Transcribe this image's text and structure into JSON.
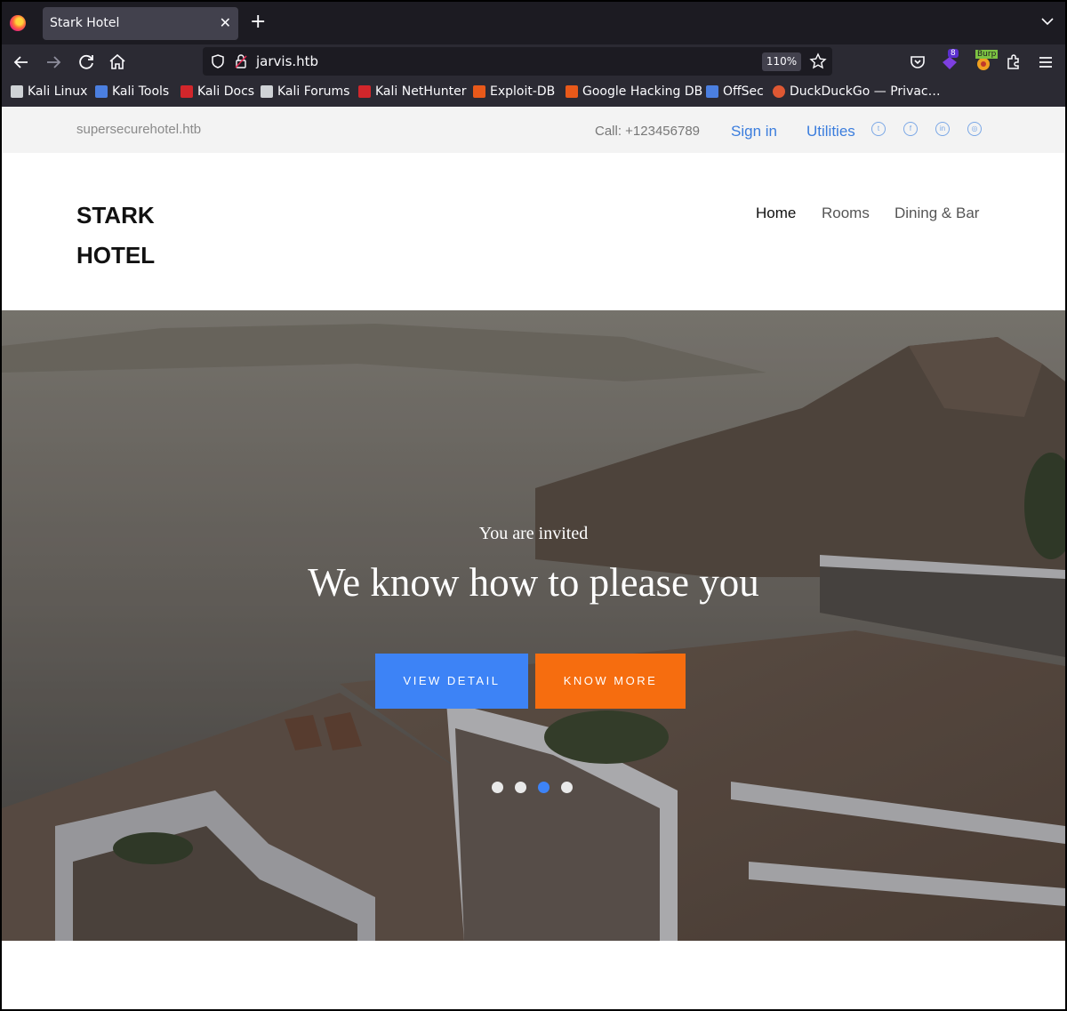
{
  "browser": {
    "tab_title": "Stark Hotel",
    "url": "jarvis.htb",
    "zoom": "110%",
    "extension_badge": "8",
    "burp_label": "Burp",
    "bookmarks": [
      {
        "label": "Kali Linux",
        "icon": "kali-dragon-icon",
        "color": "#cfd2d6"
      },
      {
        "label": "Kali Tools",
        "icon": "kali-tools-icon",
        "color": "#4b7fe0"
      },
      {
        "label": "Kali Docs",
        "icon": "kali-docs-icon",
        "color": "#d2262b"
      },
      {
        "label": "Kali Forums",
        "icon": "kali-forums-icon",
        "color": "#cfd2d6"
      },
      {
        "label": "Kali NetHunter",
        "icon": "nethunter-icon",
        "color": "#d2262b"
      },
      {
        "label": "Exploit-DB",
        "icon": "exploit-db-icon",
        "color": "#e8591a"
      },
      {
        "label": "Google Hacking DB",
        "icon": "ghdb-icon",
        "color": "#e8591a"
      },
      {
        "label": "OffSec",
        "icon": "offsec-icon",
        "color": "#4b7fe0"
      },
      {
        "label": "DuckDuckGo — Privac…",
        "icon": "duckduckgo-icon",
        "color": "#de5833"
      }
    ]
  },
  "topbar": {
    "domain": "supersecurehotel.htb",
    "phone": "Call: +123456789",
    "sign_in": "Sign in",
    "utilities": "Utilities",
    "social": [
      "twitter-icon",
      "facebook-icon",
      "linkedin-icon",
      "dribbble-icon"
    ]
  },
  "header": {
    "brand_line1": "STARK",
    "brand_line2": "HOTEL",
    "menu": [
      "Home",
      "Rooms",
      "Dining & Bar"
    ]
  },
  "hero": {
    "subtitle": "You are invited",
    "title": "We know how to please you",
    "primary_button": "VIEW DETAIL",
    "secondary_button": "KNOW MORE",
    "slides": 4,
    "active_slide": 3,
    "accent_blue": "#3d83f6",
    "accent_orange": "#f66d0f"
  }
}
